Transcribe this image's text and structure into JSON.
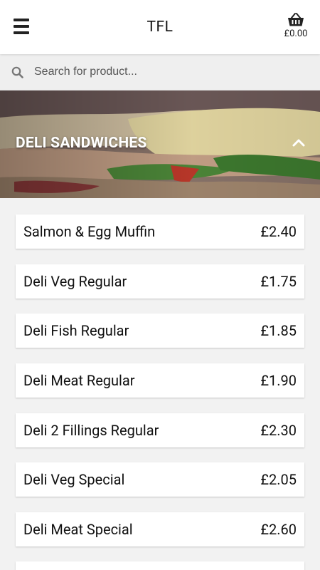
{
  "app": {
    "title": "TFL"
  },
  "header": {
    "basket_total": "£0.00"
  },
  "search": {
    "placeholder": "Search for product..."
  },
  "category": {
    "title": "DELI SANDWICHES"
  },
  "products": [
    {
      "name": "Salmon & Egg Muffin",
      "price": "£2.40"
    },
    {
      "name": "Deli Veg Regular",
      "price": "£1.75"
    },
    {
      "name": "Deli Fish Regular",
      "price": "£1.85"
    },
    {
      "name": "Deli Meat Regular",
      "price": "£1.90"
    },
    {
      "name": "Deli 2 Fillings Regular",
      "price": "£2.30"
    },
    {
      "name": "Deli Veg Special",
      "price": "£2.05"
    },
    {
      "name": "Deli Meat Special",
      "price": "£2.60"
    },
    {
      "name": "",
      "price": ""
    }
  ],
  "icons": {
    "menu": "hamburger-menu-icon",
    "basket": "shopping-basket-icon",
    "search": "search-icon",
    "collapse": "chevron-up-icon"
  },
  "colors": {
    "appbar": "#ffffff",
    "background": "#f2f2f2",
    "searchbar": "#efefef",
    "text": "#111111"
  }
}
